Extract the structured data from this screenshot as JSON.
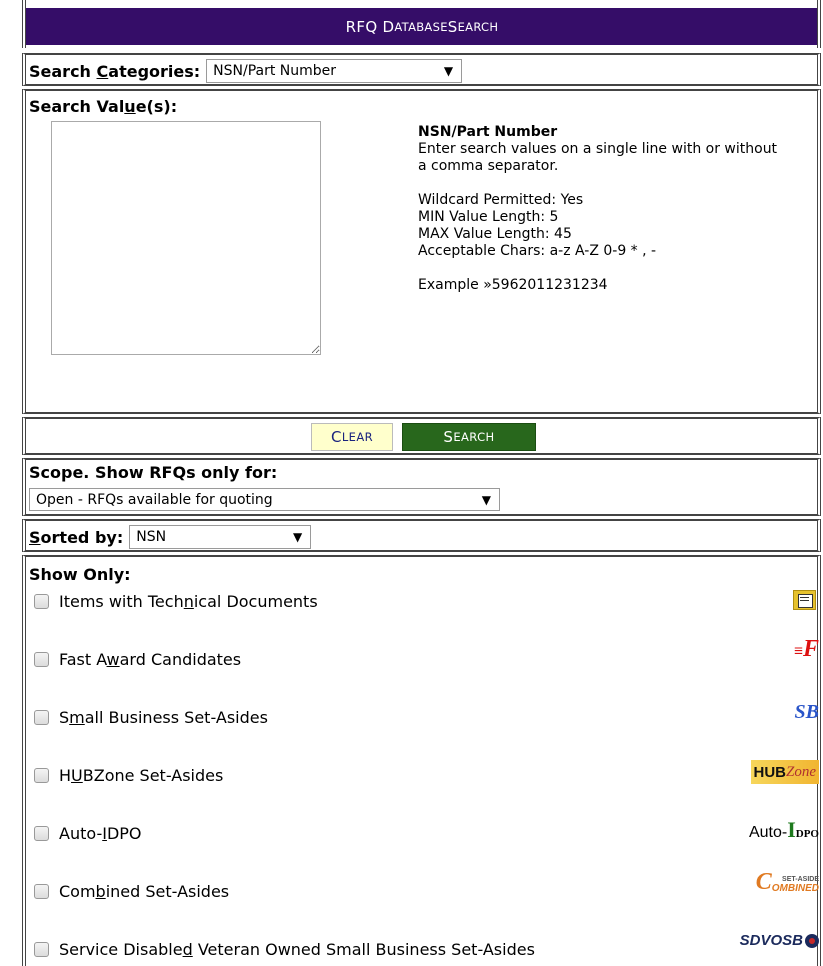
{
  "header": {
    "title_big_1": "RFQ D",
    "title_small_1": "ATABASE",
    "title_big_2": " S",
    "title_small_2": "EARCH"
  },
  "categories": {
    "label_pre": "Search ",
    "label_u": "C",
    "label_post": "ategories:",
    "selected": "NSN/Part Number"
  },
  "search_values": {
    "label_pre": "Search Val",
    "label_u": "u",
    "label_post": "e(s):",
    "help_title": "NSN/Part Number",
    "help_desc": "Enter search values on a single line with or without a comma separator.",
    "wildcard": "Wildcard Permitted: Yes",
    "min_len": "MIN Value Length: 5",
    "max_len": "MAX Value Length: 45",
    "chars": "Acceptable Chars: a-z A-Z 0-9 * , -",
    "example": "Example »5962011231234"
  },
  "buttons": {
    "clear_big": "C",
    "clear_small": "LEAR",
    "search_big": "S",
    "search_small": "EARCH"
  },
  "scope": {
    "label": "Scope. Show RFQs only for:",
    "selected": "Open - RFQs available for quoting"
  },
  "sort": {
    "label_u": "S",
    "label_post": "orted by:",
    "selected": "NSN"
  },
  "show_only": {
    "label": "Show Only:",
    "items": [
      {
        "pre": "Items with Tech",
        "u": "n",
        "post": "ical Documents"
      },
      {
        "pre": "Fast A",
        "u": "w",
        "post": "ard Candidates"
      },
      {
        "pre": "S",
        "u": "m",
        "post": "all Business Set-Asides"
      },
      {
        "pre": "H",
        "u": "U",
        "post": "BZone Set-Asides"
      },
      {
        "pre": "Auto-",
        "u": "I",
        "post": "DPO"
      },
      {
        "pre": "Com",
        "u": "b",
        "post": "ined Set-Asides"
      },
      {
        "pre": "Service Disable",
        "u": "d",
        "post": " Veteran Owned Small Business Set-Asides"
      }
    ],
    "badges": {
      "fast": "F",
      "sb": "SB",
      "hub_a": "HUB",
      "hub_b": "Zone",
      "idpo_a": "Auto-",
      "idpo_b": "I",
      "idpo_c": "DPO",
      "comb_big": "C",
      "comb_top": "SET-ASIDE",
      "comb_bottom": "OMBINED",
      "sdvosb": "SDVOSB"
    }
  }
}
